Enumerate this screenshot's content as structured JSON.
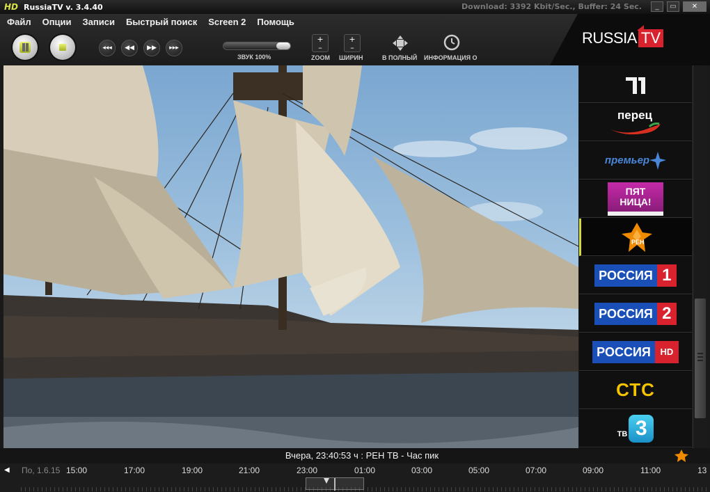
{
  "titlebar": {
    "hd_badge": "HD",
    "title": "RussiaTV v. 3.4.40",
    "stats": "Download: 3392 Kbit/Sec., Buffer: 24 Sec.",
    "minimize": "_",
    "maximize": "▭",
    "close": "✕"
  },
  "menu": [
    "Файл",
    "Опции",
    "Записи",
    "Быстрый поиск",
    "Screen 2",
    "Помощь"
  ],
  "logo": {
    "text1": "RUSSIA",
    "text2": "TV"
  },
  "controls": {
    "volume_label": "ЗВУК 100%",
    "volume_level": 1.0,
    "zoom_label": "ZOOM",
    "width_label": "ШИРИН",
    "fullscreen_label": "В ПОЛНЫЙ",
    "info_label": "ИНФОРМАЦИЯ О",
    "plus": "+",
    "minus": "–"
  },
  "channels": [
    {
      "name": "Первый",
      "logo_text": "1"
    },
    {
      "name": "Перец",
      "logo_text": "перец"
    },
    {
      "name": "Премьер",
      "logo_text": "премьер"
    },
    {
      "name": "Пятница",
      "logo_text": "ПЯТ НИЦА!"
    },
    {
      "name": "РЕН ТВ",
      "logo_text": "РЕН",
      "active": true
    },
    {
      "name": "Россия 1",
      "logo_text": "РОССИЯ",
      "badge": "1"
    },
    {
      "name": "Россия 2",
      "logo_text": "РОССИЯ",
      "badge": "2"
    },
    {
      "name": "Россия HD",
      "logo_text": "РОССИЯ",
      "badge": "HD"
    },
    {
      "name": "СТС",
      "logo_text": "СТС"
    },
    {
      "name": "ТВ3",
      "logo_text": "ТВ",
      "badge": "3"
    }
  ],
  "status": {
    "now_playing": "Вчера, 23:40:53 ч : РЕН ТВ - Час пик"
  },
  "timeline": {
    "date": "По, 1.6.15",
    "times": [
      "15:00",
      "17:00",
      "19:00",
      "21:00",
      "23:00",
      "01:00",
      "03:00",
      "05:00",
      "07:00",
      "09:00",
      "11:00",
      "13"
    ]
  },
  "colors": {
    "accent": "#d4dc3c",
    "russia_blue": "#1a4fb8",
    "russia_red": "#d8232f",
    "ctc_yellow": "#f5c400",
    "ren_orange": "#f08a00"
  }
}
